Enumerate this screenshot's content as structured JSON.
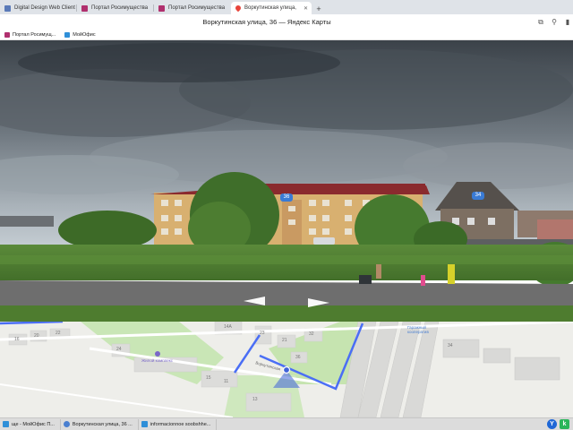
{
  "browser": {
    "tabs": [
      {
        "label": "Digital Design Web Client",
        "icon": "dd-icon",
        "color": "#5a7ab8"
      },
      {
        "label": "Портал Росимущества",
        "icon": "portal-icon",
        "color": "#b0306e"
      },
      {
        "label": "Портал Росимущества",
        "icon": "portal-icon",
        "color": "#b0306e"
      },
      {
        "label": "Воркутинская улица,",
        "icon": "map-pin-icon",
        "color": "#e8443a",
        "active": true
      }
    ],
    "title": "Воркутинская улица, 36 — Яндекс Карты",
    "bookmarks": [
      {
        "label": "Портал Росимущ...",
        "color": "#b0306e"
      },
      {
        "label": "МойОфис",
        "color": "#2f8fd8"
      }
    ]
  },
  "panorama": {
    "house_number_badge_1": "36",
    "house_number_badge_2": "34"
  },
  "map": {
    "house_numbers": [
      "16",
      "20",
      "22",
      "24",
      "14А",
      "23",
      "21",
      "36",
      "32",
      "15",
      "11",
      "13",
      "34"
    ],
    "place_label": "Жилой комплекс",
    "street_label": "Воркутинская",
    "garage_label": "Гаражный кооператив"
  },
  "taskbar": {
    "items": [
      {
        "label": "ще - МойОфис П...",
        "color": "#2f8fd8"
      },
      {
        "label": "Воркутинская улица, 36 ...",
        "color": "#4a7fd0"
      },
      {
        "label": "informacionnoe soobshhe...",
        "color": "#2f8fd8"
      }
    ],
    "tray_y_label": "Y",
    "tray_k_label": "k"
  }
}
